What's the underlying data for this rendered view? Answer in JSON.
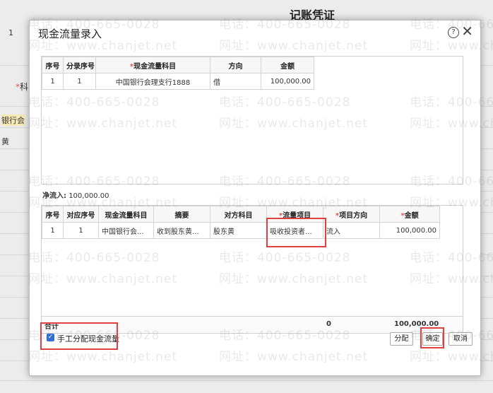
{
  "background": {
    "title": "记账凭证",
    "frag_left_1": "1",
    "frag_subject": "科",
    "frag_bank": "银行会",
    "frag_misc": "黄"
  },
  "watermark": {
    "phone": "电话：400-665-0028",
    "site": "网址：www.chanjet.net"
  },
  "dialog": {
    "title": "现金流量录入",
    "help_icon": "?",
    "close_icon": "✕",
    "top_table": {
      "headers": [
        "序号",
        "分录序号",
        "现金流量科目",
        "方向",
        "金额"
      ],
      "required_mark": "*",
      "rows": [
        [
          "1",
          "1",
          "中国银行会理支行1888",
          "借",
          "100,000.00"
        ]
      ]
    },
    "net_flow_label": "净流入:",
    "net_flow_value": "100,000.00",
    "bottom_table": {
      "headers": [
        "序号",
        "对应序号",
        "现金流量科目",
        "摘要",
        "对方科目",
        "流量项目",
        "项目方向",
        "金额"
      ],
      "required_mark": "*",
      "rows": [
        [
          "1",
          "1",
          "中国银行会...",
          "收到股东黄...",
          "股东黄",
          "吸收投资者...",
          "流入",
          "100,000.00"
        ]
      ],
      "total_label": "合计",
      "total_count": "0",
      "total_amount": "100,000.00"
    },
    "manual_checkbox": {
      "checked": true,
      "check_mark": "✓",
      "label": "手工分配现金流量"
    },
    "buttons": {
      "distribute": "分配",
      "confirm": "确定",
      "cancel": "取消"
    }
  },
  "colors": {
    "highlight": "#e04040",
    "required": "#e45454",
    "checkbox": "#2f6fd6"
  }
}
